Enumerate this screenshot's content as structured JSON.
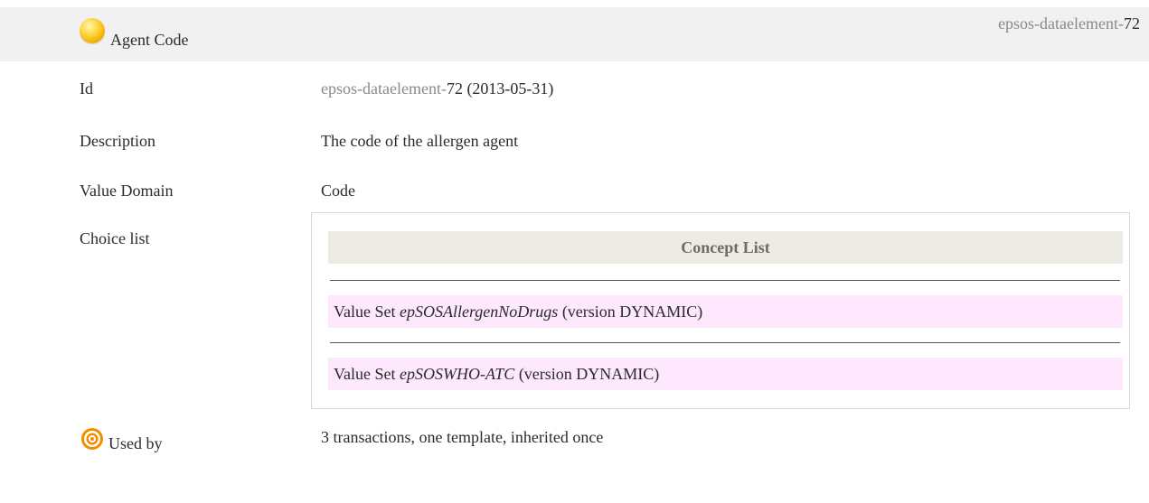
{
  "header": {
    "title": "Agent Code",
    "ref_prefix": "epsos-dataelement-",
    "ref_number": "72"
  },
  "rows": {
    "id": {
      "label": "Id",
      "value_prefix": "epsos-dataelement-",
      "value_number": "72",
      "value_date": "(2013-05-31)"
    },
    "description": {
      "label": "Description",
      "value": "The code of the allergen agent"
    },
    "value_domain": {
      "label": "Value Domain",
      "value": "Code"
    },
    "choice_list": {
      "label": "Choice list",
      "concept_list_title": "Concept List",
      "value_sets": [
        {
          "prefix": "Value Set",
          "name": "epSOSAllergenNoDrugs",
          "version": "(version DYNAMIC)"
        },
        {
          "prefix": "Value Set",
          "name": "epSOSWHO-ATC",
          "version": "(version DYNAMIC)"
        }
      ]
    },
    "used_by": {
      "label": "Used by",
      "value": "3 transactions, one template, inherited once"
    }
  },
  "icons": {
    "header_bullet": "yellow-ball-icon",
    "used_by": "target-icon"
  },
  "colors": {
    "header_bg": "#f1f1f1",
    "concept_head_bg": "#ecebe4",
    "value_set_bg": "#fde8fd",
    "target_orange": "#f28c00"
  }
}
